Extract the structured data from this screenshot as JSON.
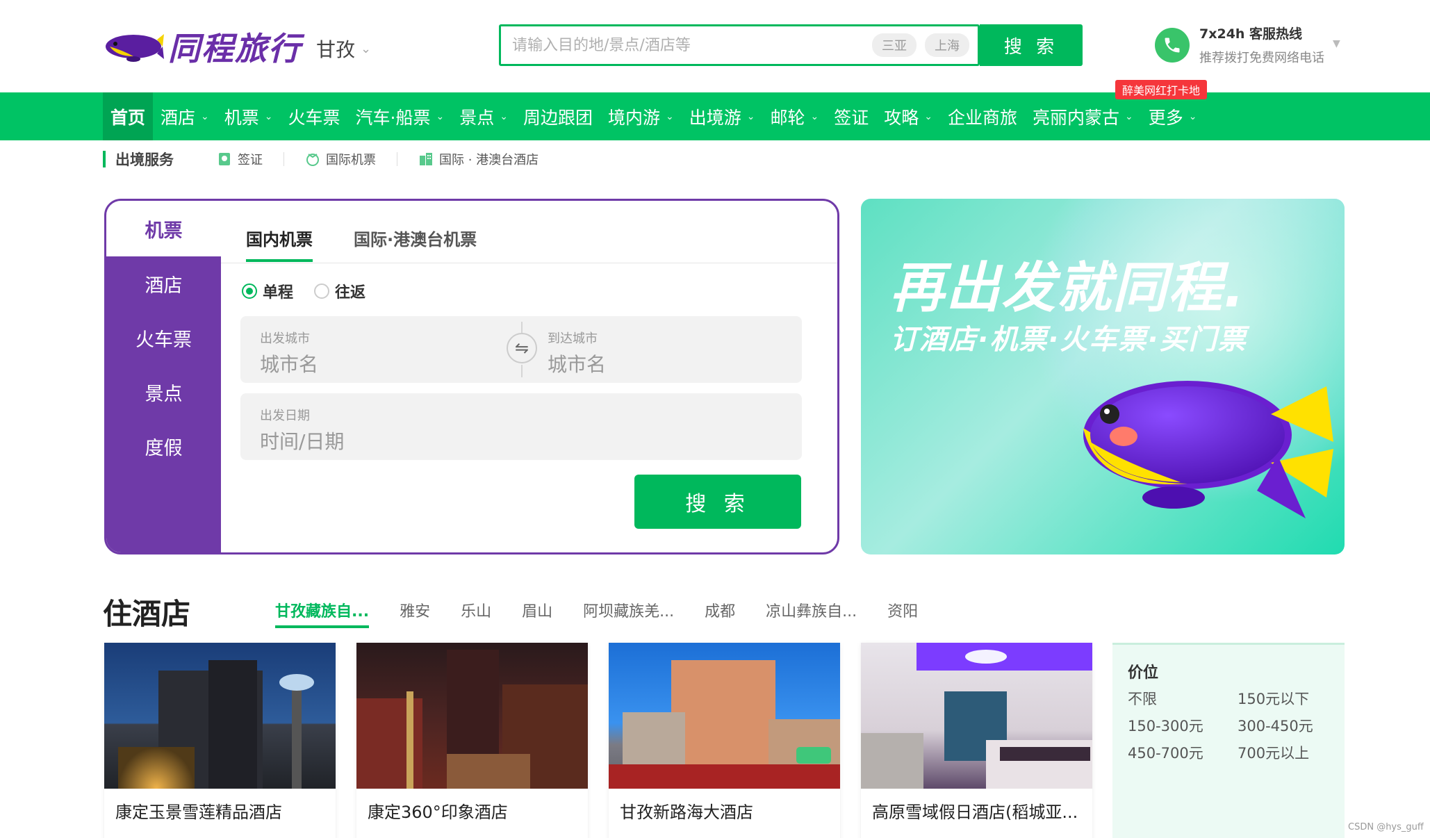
{
  "header": {
    "logo_text": "同程旅行",
    "city": "甘孜",
    "search_placeholder": "请输入目的地/景点/酒店等",
    "hot_tags": [
      "三亚",
      "上海"
    ],
    "search_button": "搜 索",
    "hotline_title": "7x24h 客服热线",
    "hotline_sub": "推荐拨打免费网络电话"
  },
  "nav": {
    "badge": "醉美网红打卡地",
    "items": [
      {
        "label": "首页",
        "dropdown": false
      },
      {
        "label": "酒店",
        "dropdown": true
      },
      {
        "label": "机票",
        "dropdown": true
      },
      {
        "label": "火车票",
        "dropdown": false
      },
      {
        "label": "汽车·船票",
        "dropdown": true
      },
      {
        "label": "景点",
        "dropdown": true
      },
      {
        "label": "周边跟团",
        "dropdown": false
      },
      {
        "label": "境内游",
        "dropdown": true
      },
      {
        "label": "出境游",
        "dropdown": true
      },
      {
        "label": "邮轮",
        "dropdown": true
      },
      {
        "label": "签证",
        "dropdown": false
      },
      {
        "label": "攻略",
        "dropdown": true
      },
      {
        "label": "企业商旅",
        "dropdown": false
      },
      {
        "label": "亮丽内蒙古",
        "dropdown": true
      },
      {
        "label": "更多",
        "dropdown": true
      }
    ]
  },
  "subnav": {
    "title": "出境服务",
    "links": [
      "签证",
      "国际机票",
      "国际 · 港澳台酒店"
    ]
  },
  "booking": {
    "side_tabs": [
      "机票",
      "酒店",
      "火车票",
      "景点",
      "度假"
    ],
    "top_tabs": [
      "国内机票",
      "国际·港澳台机票"
    ],
    "trip_types": [
      "单程",
      "往返"
    ],
    "depart_label": "出发城市",
    "depart_placeholder": "城市名",
    "arrive_label": "到达城市",
    "arrive_placeholder": "城市名",
    "date_label": "出发日期",
    "date_placeholder": "时间/日期",
    "search_button": "搜 索"
  },
  "banner": {
    "title": "再出发就同程.",
    "subtitle": "订酒店·机票·火车票·买门票"
  },
  "hotels": {
    "section_title": "住酒店",
    "city_tabs": [
      "甘孜藏族自...",
      "雅安",
      "乐山",
      "眉山",
      "阿坝藏族羌...",
      "成都",
      "凉山彝族自...",
      "资阳"
    ],
    "cards": [
      {
        "name": "康定玉景雪莲精品酒店"
      },
      {
        "name": "康定360°印象酒店"
      },
      {
        "name": "甘孜新路海大酒店"
      },
      {
        "name": "高原雪域假日酒店(稻城亚..."
      }
    ],
    "price_filter": {
      "title": "价位",
      "options": [
        "不限",
        "150元以下",
        "150-300元",
        "300-450元",
        "450-700元",
        "700元以上"
      ]
    }
  },
  "watermark": "CSDN @hys_guff",
  "colors": {
    "brand_green": "#00c364",
    "brand_purple": "#6f3aa8",
    "badge_red": "#f5363b"
  }
}
